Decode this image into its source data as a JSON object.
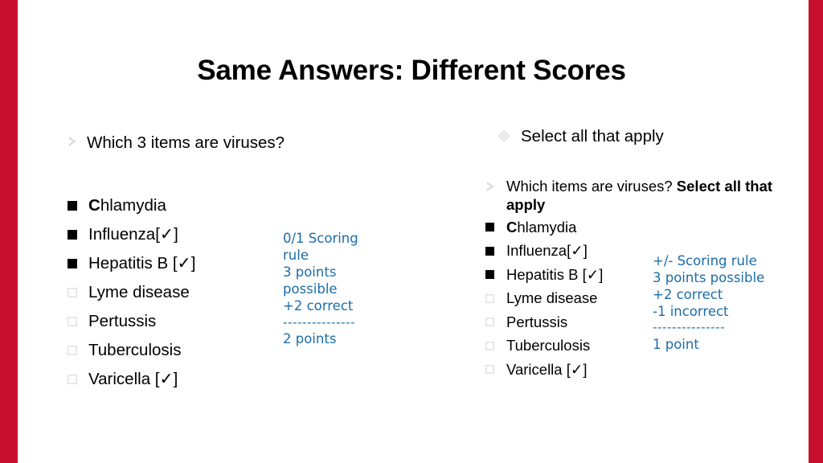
{
  "slide": {
    "title": "Same Answers: Different Scores",
    "accent_color": "#C8102E",
    "score_color": "#1B6CA8"
  },
  "left_panel": {
    "question": "Which 3 items are viruses?",
    "items": [
      {
        "label_lead": "C",
        "label_rest": "hlamydia",
        "selected": true
      },
      {
        "label_lead": "",
        "label_rest": "Influenza[✓]",
        "selected": true
      },
      {
        "label_lead": "",
        "label_rest": "Hepatitis B [✓]",
        "selected": true
      },
      {
        "label_lead": "",
        "label_rest": "Lyme disease",
        "selected": false
      },
      {
        "label_lead": "",
        "label_rest": "Pertussis",
        "selected": false
      },
      {
        "label_lead": "",
        "label_rest": "Tuberculosis",
        "selected": false
      },
      {
        "label_lead": "",
        "label_rest": "Varicella [✓]",
        "selected": false
      }
    ],
    "score": {
      "rule": "0/1  Scoring rule",
      "possible": "3 points possible",
      "correct": "+2 correct",
      "divider": "---------------",
      "total": "2 points"
    }
  },
  "right_panel": {
    "heading": "Select all that apply",
    "question_plain": "Which items are viruses? ",
    "question_bold": "Select all that apply",
    "items": [
      {
        "label_lead": "C",
        "label_rest": "hlamydia",
        "selected": true
      },
      {
        "label_lead": "",
        "label_rest": "Influenza[✓]",
        "selected": true
      },
      {
        "label_lead": "",
        "label_rest": "Hepatitis B [✓]",
        "selected": true
      },
      {
        "label_lead": "",
        "label_rest": "Lyme disease",
        "selected": false
      },
      {
        "label_lead": "",
        "label_rest": "Pertussis",
        "selected": false
      },
      {
        "label_lead": "",
        "label_rest": "Tuberculosis",
        "selected": false
      },
      {
        "label_lead": "",
        "label_rest": "Varicella [✓]",
        "selected": false
      }
    ],
    "score": {
      "rule": "+/- Scoring rule",
      "possible": "3 points possible",
      "correct": "+2 correct",
      "incorrect": "-1 incorrect",
      "divider": "---------------",
      "total": "1 point"
    }
  }
}
